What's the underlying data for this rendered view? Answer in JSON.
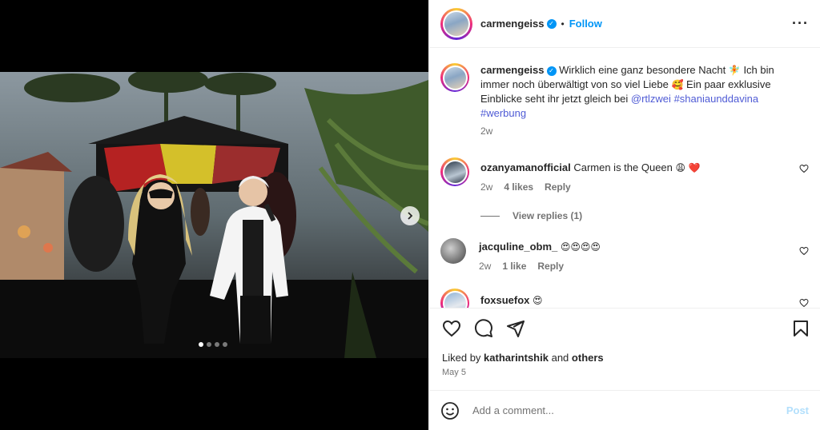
{
  "header": {
    "username": "carmengeiss",
    "separator": "•",
    "follow_label": "Follow",
    "more_icon": "more-horizontal-icon"
  },
  "caption": {
    "username": "carmengeiss",
    "text_1": "Wirklich eine ganz besondere Nacht",
    "emoji_1": "🧚",
    "text_2": "Ich bin immer noch überwältigt von so viel Liebe",
    "emoji_2": "🥰",
    "text_3": "Ein paar exklusive Einblicke seht ihr jetzt gleich bei",
    "mention": "@rtlzwei",
    "hashtag_1": "#shaniaunddavina",
    "hashtag_2": "#werbung",
    "time": "2w"
  },
  "comments": [
    {
      "username": "ozanyamanofficial",
      "text": "Carmen is the Queen",
      "emoji": "😩 ❤️",
      "time": "2w",
      "likes": "4 likes",
      "reply": "Reply",
      "view_replies": "View replies (1)"
    },
    {
      "username": "jacquline_obm_",
      "text": "",
      "emoji": "😍😍😍😍",
      "time": "2w",
      "likes": "1 like",
      "reply": "Reply"
    },
    {
      "username": "foxsuefox",
      "text": "",
      "emoji": "😍"
    }
  ],
  "actions": {
    "like_icon": "heart-icon",
    "comment_icon": "comment-icon",
    "share_icon": "share-icon",
    "save_icon": "bookmark-icon"
  },
  "liked_by": {
    "prefix": "Liked by",
    "user": "katharintshik",
    "and": "and",
    "others": "others"
  },
  "date": "May 5",
  "composer": {
    "placeholder": "Add a comment...",
    "post_label": "Post",
    "emoji_icon": "smiley-icon"
  },
  "carousel": {
    "total": 4,
    "active_index": 0
  },
  "colors": {
    "accent": "#0095f6",
    "link": "#4f5bd5",
    "post_disabled": "#b2dffc",
    "heart_red": "#ed1c24"
  }
}
